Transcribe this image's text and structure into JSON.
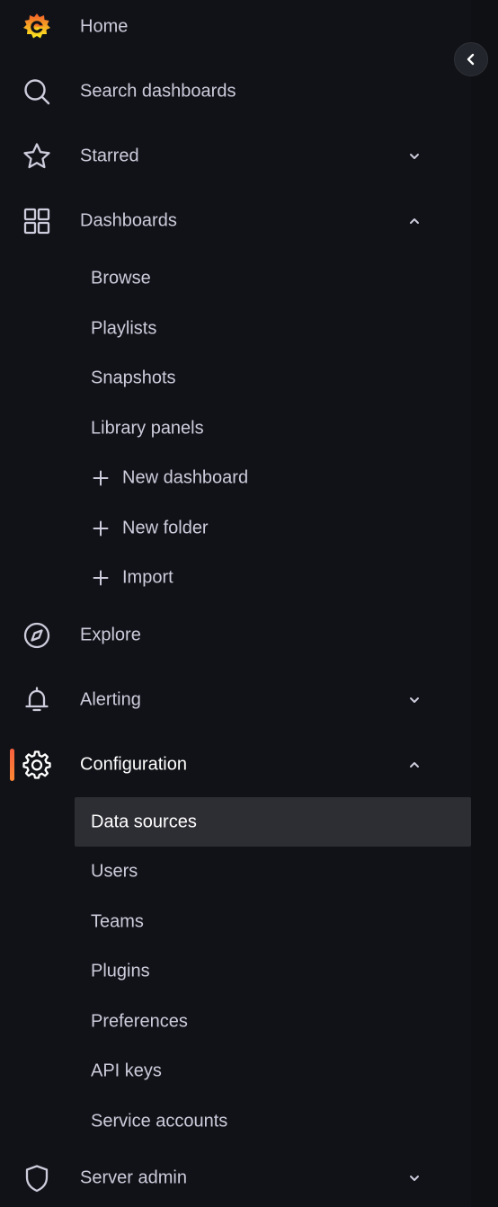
{
  "nav": {
    "home": {
      "label": "Home"
    },
    "search": {
      "label": "Search dashboards"
    },
    "starred": {
      "label": "Starred"
    },
    "dashboards": {
      "label": "Dashboards",
      "children": {
        "browse": "Browse",
        "playlists": "Playlists",
        "snapshots": "Snapshots",
        "library_panels": "Library panels",
        "new_dashboard": "New dashboard",
        "new_folder": "New folder",
        "import": "Import"
      }
    },
    "explore": {
      "label": "Explore"
    },
    "alerting": {
      "label": "Alerting"
    },
    "configuration": {
      "label": "Configuration",
      "children": {
        "data_sources": "Data sources",
        "users": "Users",
        "teams": "Teams",
        "plugins": "Plugins",
        "preferences": "Preferences",
        "api_keys": "API keys",
        "service_accounts": "Service accounts"
      }
    },
    "server_admin": {
      "label": "Server admin"
    }
  },
  "state": {
    "active_section": "configuration",
    "selected_item": "data_sources",
    "expanded_sections": [
      "dashboards",
      "configuration"
    ]
  },
  "colors": {
    "nav_bg": "#111217",
    "text": "#ccccdc",
    "active_text": "#ffffff",
    "selected_bg": "#2d2e34",
    "accent_start": "#f55f3e",
    "accent_end": "#ff8833"
  }
}
